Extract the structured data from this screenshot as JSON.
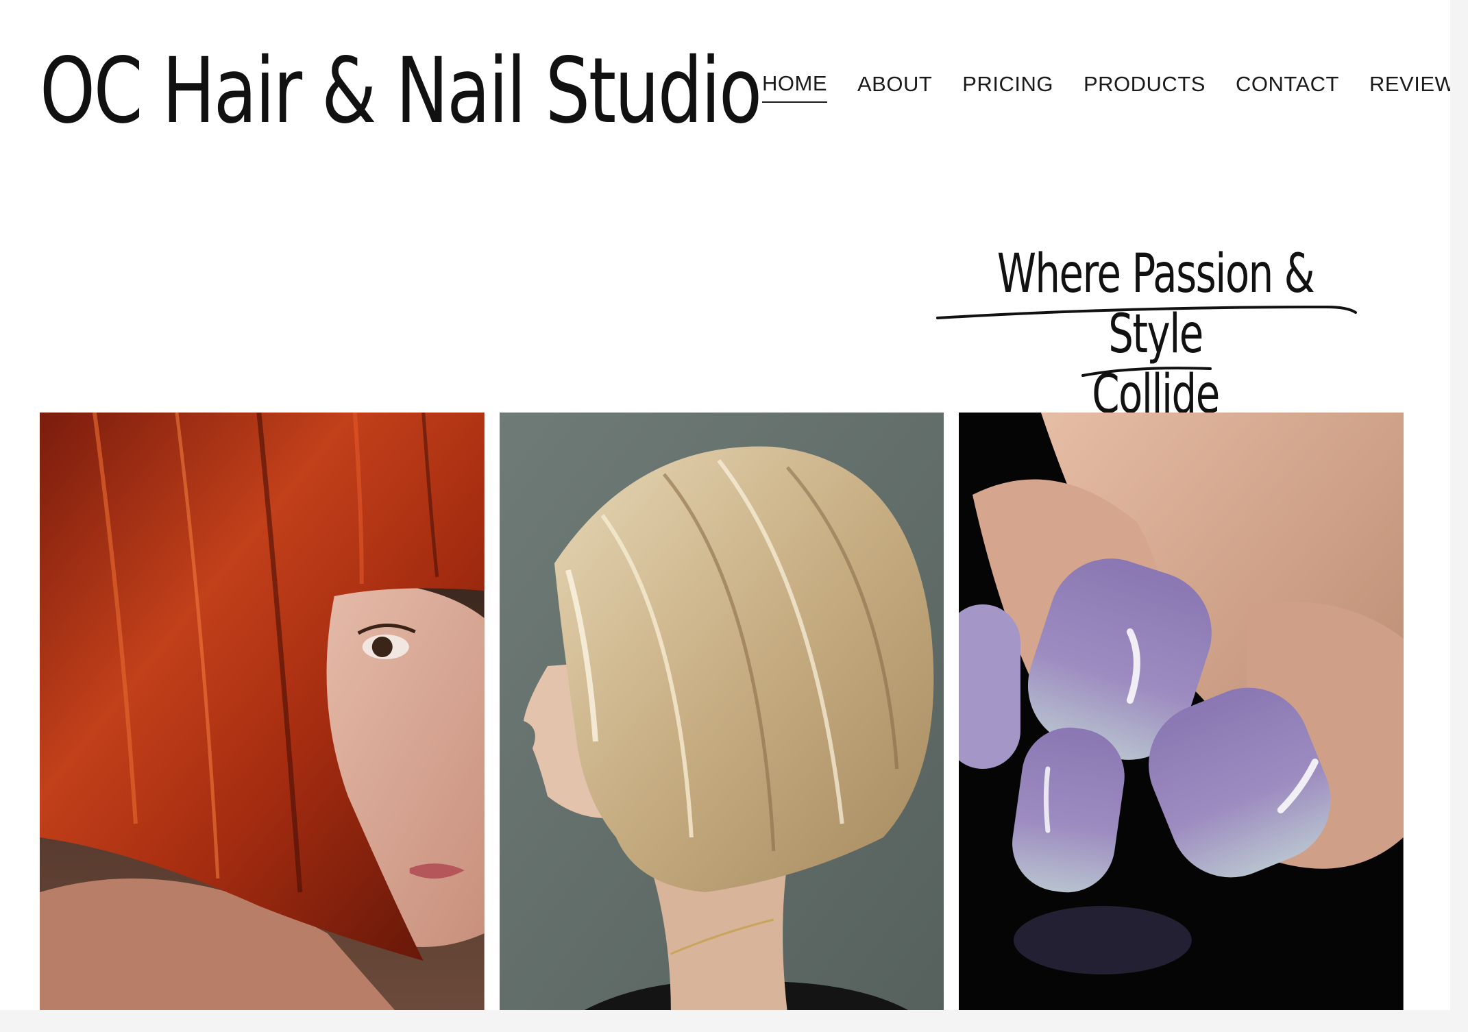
{
  "header": {
    "site_title": "OC Hair & Nail Studio"
  },
  "nav": {
    "items": [
      {
        "label": "HOME",
        "active": true
      },
      {
        "label": "ABOUT",
        "active": false
      },
      {
        "label": "PRICING",
        "active": false
      },
      {
        "label": "PRODUCTS",
        "active": false
      },
      {
        "label": "CONTACT",
        "active": false
      },
      {
        "label": "REVIEWS",
        "active": false
      }
    ]
  },
  "hero": {
    "tagline_line1": "Where Passion & Style",
    "tagline_line2": "Collide"
  },
  "gallery": {
    "images": [
      {
        "subject": "red-bob-haircut-photo"
      },
      {
        "subject": "blonde-bob-haircut-photo"
      },
      {
        "subject": "lavender-nails-photo"
      }
    ]
  },
  "colors": {
    "text": "#111111",
    "background": "#ffffff"
  }
}
